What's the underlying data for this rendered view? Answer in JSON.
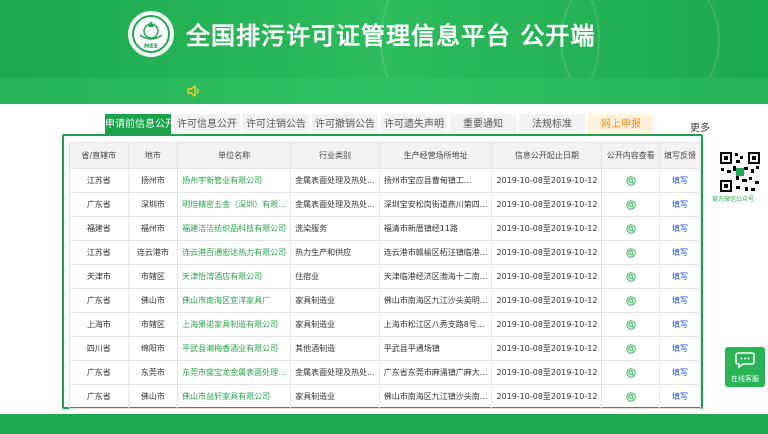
{
  "header": {
    "title": "全国排污许可证管理信息平台  公开端",
    "logo_text": "MEE",
    "brand_color": "#1ea94f"
  },
  "notice": {
    "icon": "speaker-icon"
  },
  "tabs": [
    {
      "label": "申请前信息公开",
      "active": true
    },
    {
      "label": "许可信息公开"
    },
    {
      "label": "许可注销公告"
    },
    {
      "label": "许可撤销公告"
    },
    {
      "label": "许可遗失声明"
    },
    {
      "label": "重要通知"
    },
    {
      "label": "法规标准"
    },
    {
      "label": "网上申报"
    }
  ],
  "more_label": "更多",
  "table": {
    "headers": [
      "省/直辖市",
      "地市",
      "单位名称",
      "行业类别",
      "生产经营场所地址",
      "信息公开起止日期",
      "公开内容查看",
      "填写反馈"
    ],
    "rows": [
      {
        "province": "江苏省",
        "city": "扬州市",
        "company": "扬州宇新管业有限公司",
        "industry": "金属表面处理及热处...",
        "address": "扬州市宝应县曹甸镇工...",
        "dates": "2019-10-08至2019-10-12",
        "feedback": "填写"
      },
      {
        "province": "广东省",
        "city": "深圳市",
        "company": "明培精密五金（深圳）有限...",
        "industry": "金属表面处理及热处...",
        "address": "深圳宝安松岗街道燕川第四...",
        "dates": "2019-10-08至2019-10-12",
        "feedback": "填写"
      },
      {
        "province": "福建省",
        "city": "福州市",
        "company": "福建洁洁纺织品科技有限公司",
        "industry": "洗染服务",
        "address": "福清市新厝镇经11路",
        "dates": "2019-10-08至2019-10-12",
        "feedback": "填写"
      },
      {
        "province": "江苏省",
        "city": "连云港市",
        "company": "连云港百通宏达热力有限公司",
        "industry": "热力生产和供应",
        "address": "连云港市赣榆区柘汪镇临港...",
        "dates": "2019-10-08至2019-10-12",
        "feedback": "填写"
      },
      {
        "province": "天津市",
        "city": "市辖区",
        "company": "天津怡湾酒店有限公司",
        "industry": "住宿业",
        "address": "天津临港经济区渤海十二南...",
        "dates": "2019-10-08至2019-10-12",
        "feedback": "填写"
      },
      {
        "province": "广东省",
        "city": "佛山市",
        "company": "佛山市南海区宜洋家具厂",
        "industry": "家具制造业",
        "address": "佛山市南海区九江沙头英明...",
        "dates": "2019-10-08至2019-10-12",
        "feedback": "填写"
      },
      {
        "province": "上海市",
        "city": "市辖区",
        "company": "上海果诺家具制造有限公司",
        "industry": "家具制造业",
        "address": "上海市松江区八秀支路8号...",
        "dates": "2019-10-08至2019-10-12",
        "feedback": "填写"
      },
      {
        "province": "四川省",
        "city": "绵阳市",
        "company": "平武县濑梅香酒业有限公司",
        "industry": "其他酒制造",
        "address": "平武县平通场镇",
        "dates": "2019-10-08至2019-10-12",
        "feedback": "填写"
      },
      {
        "province": "广东省",
        "city": "东莞市",
        "company": "东莞市盛宝龙金属表面处理...",
        "industry": "金属表面处理及热处...",
        "address": "广东省东莞市麻涌镇广麻大...",
        "dates": "2019-10-08至2019-10-12",
        "feedback": "填写"
      },
      {
        "province": "广东省",
        "city": "佛山市",
        "company": "佛山市益轩家具有限公司",
        "industry": "家具制造业",
        "address": "佛山市南海区九江镇沙头南...",
        "dates": "2019-10-08至2019-10-12",
        "feedback": "填写"
      }
    ]
  },
  "qr": {
    "label": "官方微信公众号"
  },
  "chat": {
    "label": "在线客服"
  }
}
